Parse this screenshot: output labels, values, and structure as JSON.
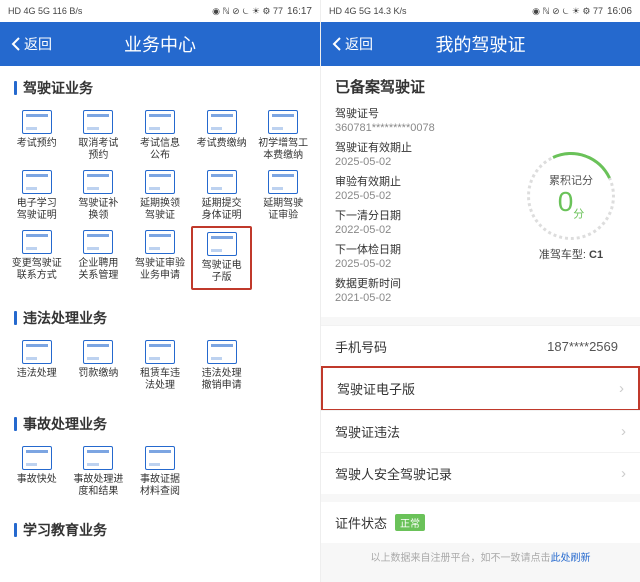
{
  "left": {
    "status": {
      "carrier": "HD 4G 5G 116 B/s",
      "time": "16:17",
      "icons": "◉ ℕ ⊘ ⏾ ☀ ⚙ 77"
    },
    "back": "返回",
    "title": "业务中心",
    "sections": [
      {
        "title": "驾驶证业务",
        "items": [
          "考试预约",
          "取消考试\n预约",
          "考试信息\n公布",
          "考试费缴纳",
          "初学增驾工\n本费缴纳",
          "电子学习\n驾驶证明",
          "驾驶证补\n换领",
          "延期换领\n驾驶证",
          "延期提交\n身体证明",
          "延期驾驶\n证审验",
          "变更驾驶证\n联系方式",
          "企业聘用\n关系管理",
          "驾驶证审验\n业务申请",
          "驾驶证电\n子版",
          ""
        ],
        "highlight_index": 13
      },
      {
        "title": "违法处理业务",
        "items": [
          "违法处理",
          "罚款缴纳",
          "租赁车违\n法处理",
          "违法处理\n撤销申请",
          ""
        ]
      },
      {
        "title": "事故处理业务",
        "items": [
          "事故快处",
          "事故处理进\n度和结果",
          "事故证据\n材料查阅",
          "",
          ""
        ]
      },
      {
        "title": "学习教育业务",
        "items": []
      }
    ]
  },
  "right": {
    "status": {
      "carrier": "HD 4G 5G 14.3 K/s",
      "time": "16:06",
      "icons": "◉ ℕ ⊘ ⏾ ☀ ⚙ 77"
    },
    "back": "返回",
    "title": "我的驾驶证",
    "license": {
      "heading": "已备案驾驶证",
      "fields": [
        {
          "k": "驾驶证号",
          "v": "360781*********0078"
        },
        {
          "k": "驾驶证有效期止",
          "v": "2025-05-02"
        },
        {
          "k": "审验有效期止",
          "v": "2025-05-02"
        },
        {
          "k": "下一清分日期",
          "v": "2022-05-02"
        },
        {
          "k": "下一体检日期",
          "v": "2025-05-02"
        },
        {
          "k": "数据更新时间",
          "v": "2021-05-02"
        }
      ],
      "gauge_label": "累积记分",
      "gauge_value": "0",
      "gauge_unit": "分",
      "class_label": "准驾车型:",
      "class_value": "C1"
    },
    "phone_label": "手机号码",
    "phone_value": "187****2569",
    "rows": [
      {
        "label": "驾驶证电子版",
        "highlight": true
      },
      {
        "label": "驾驶证违法"
      },
      {
        "label": "驾驶人安全驾驶记录"
      }
    ],
    "cert_state_label": "证件状态",
    "cert_state_value": "正常",
    "footer_pre": "以上数据来自注册平台，如不一致请点击",
    "footer_link": "此处刷新"
  }
}
